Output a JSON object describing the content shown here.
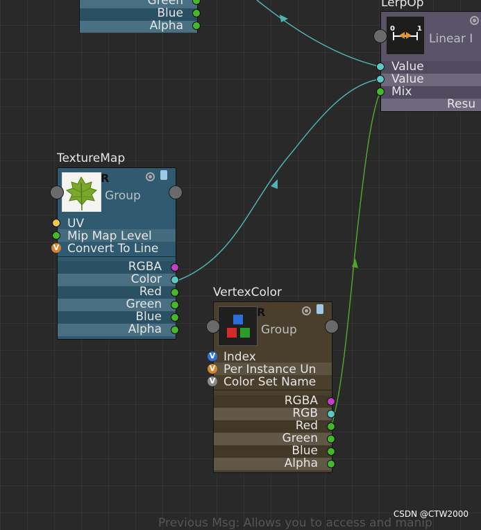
{
  "top_node": {
    "rows": [
      "Green",
      "Blue",
      "Alpha"
    ]
  },
  "lerp_node": {
    "title": "LerpOp",
    "subtitle": "Linear I",
    "icon_label_left": "0",
    "icon_label_right": "1",
    "inputs": [
      "Value",
      "Value",
      "Mix"
    ],
    "output": "Resu"
  },
  "texture_node": {
    "title": "TextureMap",
    "group": "Group",
    "r_label": "R",
    "inputs": [
      {
        "label": "UV",
        "port": "yellow-dot"
      },
      {
        "label": "Mip Map Level",
        "port": "green-dot"
      },
      {
        "label": "Convert To Line",
        "port": "v-badge",
        "badge": "V"
      }
    ],
    "outputs": [
      "RGBA",
      "Color",
      "Red",
      "Green",
      "Blue",
      "Alpha"
    ]
  },
  "vertex_node": {
    "title": "VertexColor",
    "group": "Group",
    "r_label": "R",
    "inputs": [
      {
        "label": "Index",
        "badge": "V"
      },
      {
        "label": "Per Instance Un",
        "badge": "V"
      },
      {
        "label": "Color Set Name",
        "badge": "V"
      }
    ],
    "outputs": [
      "RGBA",
      "RGB",
      "Red",
      "Green",
      "Blue",
      "Alpha"
    ]
  },
  "status_bar": {
    "text": "Previous Msg: Allows you to access and manip"
  },
  "watermark": {
    "text": "CSDN @CTW2000"
  },
  "colors": {
    "blue_node": "#2f5a70",
    "lerp_node": "#5a536a",
    "vertex_node": "#4a3f2c",
    "wire_cyan": "#4fb3b4",
    "wire_green": "#4fa52a"
  }
}
